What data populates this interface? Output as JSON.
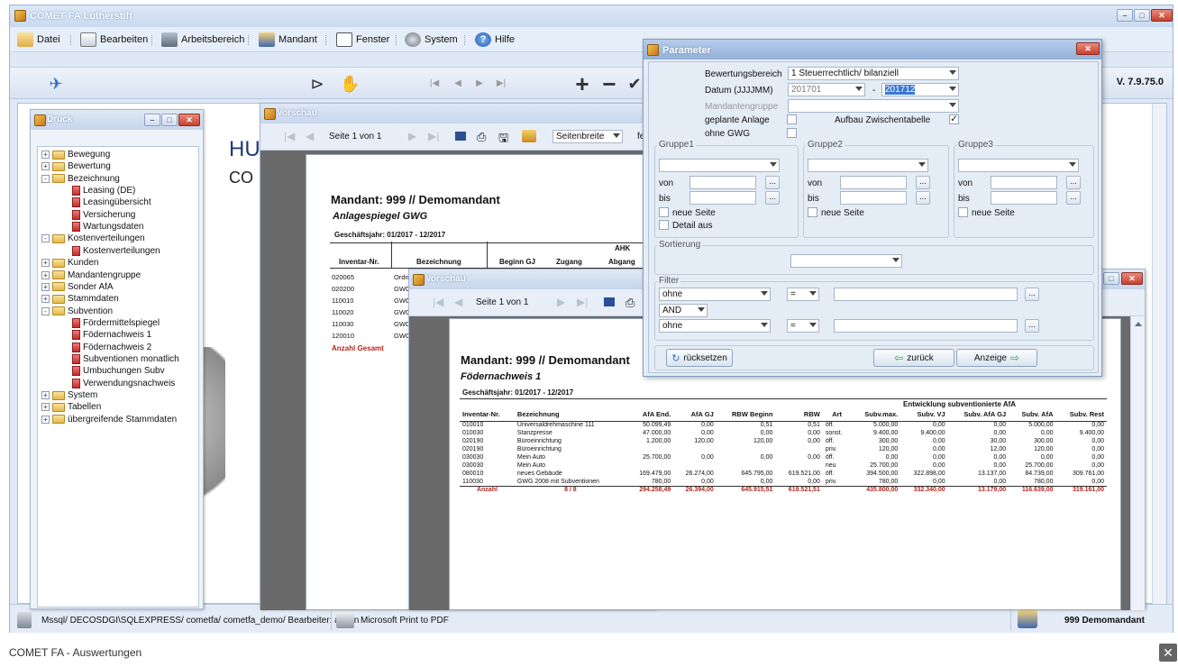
{
  "app": {
    "title": "COMET FA Lutherstift",
    "version": "V. 7.9.75.0",
    "menu": [
      "Datei",
      "Bearbeiten",
      "Arbeitsbereich",
      "Mandant",
      "Fenster",
      "System",
      "Hilfe"
    ]
  },
  "background": {
    "line1": "HU",
    "line2": "CO"
  },
  "druck": {
    "title": "Druck",
    "tree": [
      {
        "label": "Bewegung",
        "level": 0,
        "type": "folder",
        "exp": "+"
      },
      {
        "label": "Bewertung",
        "level": 0,
        "type": "folder",
        "exp": "+"
      },
      {
        "label": "Bezeichnung",
        "level": 0,
        "type": "folder",
        "exp": "-"
      },
      {
        "label": "Leasing (DE)",
        "level": 1,
        "type": "page"
      },
      {
        "label": "Leasingübersicht",
        "level": 1,
        "type": "page"
      },
      {
        "label": "Versicherung",
        "level": 1,
        "type": "page"
      },
      {
        "label": "Wartungsdaten",
        "level": 1,
        "type": "page"
      },
      {
        "label": "Kostenverteilungen",
        "level": 0,
        "type": "folder",
        "exp": "-"
      },
      {
        "label": "Kostenverteilungen",
        "level": 1,
        "type": "page"
      },
      {
        "label": "Kunden",
        "level": 0,
        "type": "folder",
        "exp": "+"
      },
      {
        "label": "Mandantengruppe",
        "level": 0,
        "type": "folder",
        "exp": "+"
      },
      {
        "label": "Sonder AfA",
        "level": 0,
        "type": "folder",
        "exp": "+"
      },
      {
        "label": "Stammdaten",
        "level": 0,
        "type": "folder",
        "exp": "+"
      },
      {
        "label": "Subvention",
        "level": 0,
        "type": "folder",
        "exp": "-"
      },
      {
        "label": "Fördermittelspiegel",
        "level": 1,
        "type": "page"
      },
      {
        "label": "Födernachweis 1",
        "level": 1,
        "type": "page"
      },
      {
        "label": "Födernachweis 2",
        "level": 1,
        "type": "page"
      },
      {
        "label": "Subventionen monatlich",
        "level": 1,
        "type": "page"
      },
      {
        "label": "Umbuchungen Subv",
        "level": 1,
        "type": "page"
      },
      {
        "label": "Verwendungsnachweis",
        "level": 1,
        "type": "page"
      },
      {
        "label": "System",
        "level": 0,
        "type": "folder",
        "exp": "+"
      },
      {
        "label": "Tabellen",
        "level": 0,
        "type": "folder",
        "exp": "+"
      },
      {
        "label": "übergreifende Stammdaten",
        "level": 0,
        "type": "folder",
        "exp": "+"
      }
    ]
  },
  "vorschau1": {
    "title": "Vorschau",
    "page_label": "Seite 1 von 1",
    "zoom": "Seitenbreite",
    "zoom_extra": "fe",
    "report_title": "Mandant: 999 // Demomandant",
    "report_subtitle": "Anlagespiegel GWG",
    "period": "Geschäftsjahr: 01/2017 - 12/2017",
    "headers": [
      "Inventar-Nr.",
      "Bezeichnung",
      "Beginn GJ",
      "Zugang",
      "Abgang"
    ],
    "group_header": "AHK",
    "rows": [
      [
        "020065",
        "Ordn"
      ],
      [
        "020200",
        "GWG"
      ],
      [
        "110010",
        "GWG"
      ],
      [
        "110020",
        "GWG"
      ],
      [
        "110030",
        "GWG"
      ],
      [
        "120010",
        "GWG"
      ]
    ],
    "total_label": "Anzahl Gesamt"
  },
  "vorschau2": {
    "title": "Vorschau",
    "page_label": "Seite 1 von 1",
    "report_title": "Mandant: 999 // Demomandant",
    "report_subtitle": "Födernachweis 1",
    "period": "Geschäftsjahr: 01/2017 - 12/2017",
    "group_header": "Entwicklung subventionierte AfA",
    "headers": [
      "Inventar-Nr.",
      "Bezeichnung",
      "AfA End.",
      "AfA GJ",
      "RBW Beginn",
      "RBW",
      "Art",
      "Subv.max.",
      "Subv. VJ",
      "Subv. AfA GJ",
      "Subv. AfA",
      "Subv. Rest"
    ],
    "rows": [
      [
        "010010",
        "Universaldrehmaschine 111",
        "50.099,49",
        "0,00",
        "0,51",
        "0,51",
        "öff.",
        "5.000,00",
        "0,00",
        "0,00",
        "5.000,00",
        "0,00"
      ],
      [
        "010030",
        "Stanzpresse",
        "47.000,00",
        "0,00",
        "0,00",
        "0,00",
        "sonst.",
        "9.400,00",
        "9.400,00",
        "0,00",
        "0,00",
        "9.400,00"
      ],
      [
        "020190",
        "Büroeinrichtung",
        "1.200,00",
        "120,00",
        "120,00",
        "0,00",
        "öff.",
        "300,00",
        "0,00",
        "30,00",
        "300,00",
        "0,00"
      ],
      [
        "020190",
        "Büroeinrichtung",
        "",
        "",
        "",
        "",
        "priv.",
        "120,00",
        "0,00",
        "12,00",
        "120,00",
        "0,00"
      ],
      [
        "030030",
        "Mein Auto",
        "25.700,00",
        "0,00",
        "0,00",
        "0,00",
        "öff.",
        "0,00",
        "0,00",
        "0,00",
        "0,00",
        "0,00"
      ],
      [
        "030030",
        "Mein Auto",
        "",
        "",
        "",
        "",
        "neu",
        "25.700,00",
        "0,00",
        "0,00",
        "25.700,00",
        "0,00"
      ],
      [
        "080010",
        "neues Gebäude",
        "169.479,00",
        "26.274,00",
        "645.795,00",
        "619.521,00",
        "öff.",
        "394.500,00",
        "322.898,00",
        "13.137,00",
        "84.739,00",
        "309.761,00"
      ],
      [
        "110030",
        "GWG 2008 mit Subventionen",
        "780,00",
        "0,00",
        "0,00",
        "0,00",
        "priv.",
        "780,00",
        "0,00",
        "0,00",
        "780,00",
        "0,00"
      ]
    ],
    "total": [
      "Anzahl",
      "8 / 8",
      "294.258,49",
      "26.394,00",
      "645.915,51",
      "619.521,51",
      "",
      "435.800,00",
      "332.340,00",
      "13.179,00",
      "116.639,00",
      "319.161,00"
    ]
  },
  "parameter": {
    "title": "Parameter",
    "bewertungsbereich_label": "Bewertungsbereich",
    "bewertungsbereich_value": "1 Steuerrechtlich/ bilanziell",
    "datum_label": "Datum (JJJJMM)",
    "datum_from": "201701",
    "datum_dash": "-",
    "datum_to": "201712",
    "mandantengruppe_label": "Mandantengruppe",
    "geplante_label": "geplante Anlage",
    "aufbau_label": "Aufbau Zwischentabelle",
    "ohne_gwg_label": "ohne GWG",
    "checkmark": "✓",
    "groups": [
      {
        "title": "Gruppe1",
        "von": "von",
        "bis": "bis",
        "neue_seite": "neue Seite",
        "detail": "Detail aus"
      },
      {
        "title": "Gruppe2",
        "von": "von",
        "bis": "bis",
        "neue_seite": "neue Seite"
      },
      {
        "title": "Gruppe3",
        "von": "von",
        "bis": "bis",
        "neue_seite": "neue Seite"
      }
    ],
    "dots": "...",
    "sortierung_label": "Sortierung",
    "filter_label": "Filter",
    "filter1_field": "ohne",
    "filter1_op": "=",
    "filter_join": "AND",
    "filter2_field": "ohne",
    "filter2_op": "=",
    "btn_reset": "rücksetzen",
    "btn_back": "zurück",
    "btn_show": "Anzeige"
  },
  "status": {
    "db": "Mssql/ DECOSDGI\\SQLEXPRESS/ cometfa/ cometfa_demo/ Bearbeiter: admin",
    "printer": "Microsoft Print to PDF",
    "mandant": "999  Demomandant"
  },
  "caption": "COMET FA - Auswertungen",
  "caption_close": "✕"
}
